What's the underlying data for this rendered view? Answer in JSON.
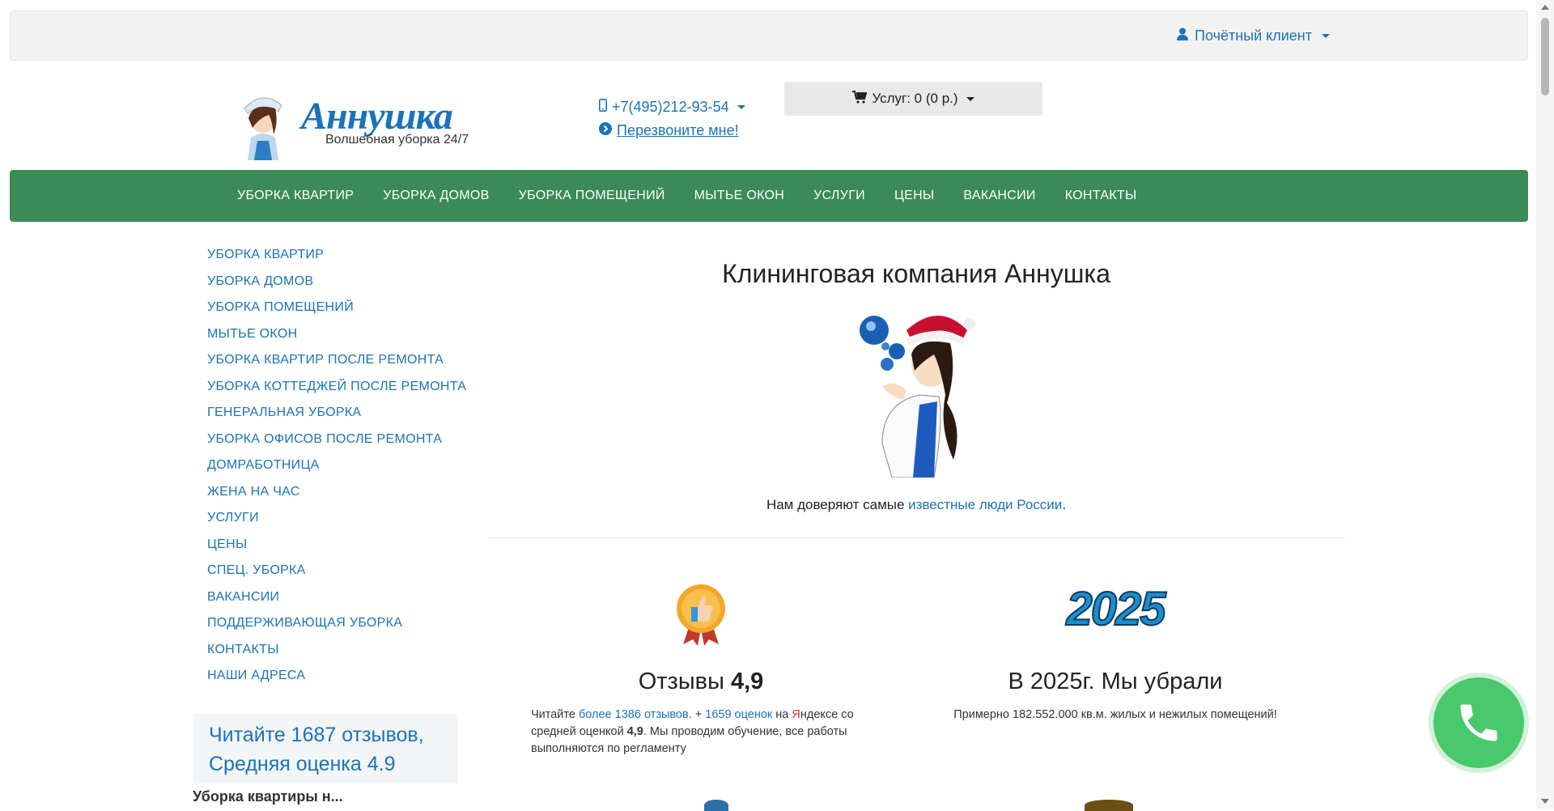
{
  "topbar": {
    "account_label": "Почётный клиент"
  },
  "header": {
    "logo_title": "Аннушка",
    "logo_subtitle": "Волшебная уборка 24/7",
    "phone": "+7(495)212-93-54",
    "callback": "Перезвоните мне!",
    "cart_label": "Услуг: 0 (0 р.)"
  },
  "mainnav": {
    "items": [
      "УБОРКА КВАРТИР",
      "УБОРКА ДОМОВ",
      "УБОРКА ПОМЕЩЕНИЙ",
      "МЫТЬЕ ОКОН",
      "УСЛУГИ",
      "ЦЕНЫ",
      "ВАКАНСИИ",
      "КОНТАКТЫ"
    ]
  },
  "sidebar": {
    "items": [
      "УБОРКА КВАРТИР",
      "УБОРКА ДОМОВ",
      "УБОРКА ПОМЕЩЕНИЙ",
      "МЫТЬЕ ОКОН",
      "УБОРКА КВАРТИР ПОСЛЕ РЕМОНТА",
      "УБОРКА КОТТЕДЖЕЙ ПОСЛЕ РЕМОНТА",
      "ГЕНЕРАЛЬНАЯ УБОРКА",
      "УБОРКА ОФИСОВ ПОСЛЕ РЕМОНТА",
      "ДОМРАБОТНИЦА",
      "ЖЕНА НА ЧАС",
      "УСЛУГИ",
      "ЦЕНЫ",
      "СПЕЦ. УБОРКА",
      "ВАКАНСИИ",
      "ПОДДЕРЖИВАЮЩАЯ УБОРКА",
      "КОНТАКТЫ",
      "НАШИ АДРЕСА"
    ],
    "reviews_line1": "Читайте 1687 отзывов,",
    "reviews_line2": "Средняя оценка 4.9",
    "subhead": "Уборка квартиры н..."
  },
  "main": {
    "title": "Клининговая компания Аннушка",
    "trust_prefix": "Нам доверяют самые ",
    "trust_link": "известные люди России",
    "trust_suffix": ".",
    "card1": {
      "title_prefix": "Отзывы ",
      "title_rating": "4,9",
      "t_read": "Читайте ",
      "t_link1": "более 1386 отзывов.",
      "t_plus": " + ",
      "t_link2": "1659 оценок",
      "t_on": " на ",
      "t_ya": "Я",
      "t_ndex": "ндексе со средней оценкой ",
      "t_rating": "4,9",
      "t_rest": ". Мы проводим обучение, все работы выполняются по регламенту"
    },
    "card2": {
      "badge": "2025",
      "title": "В 2025г. Мы убрали",
      "text": "Примерно 182.552.000 кв.м. жилых и нежилых помещений!"
    }
  },
  "colors": {
    "nav_green": "#3b8a57",
    "link_blue": "#1a73b8",
    "fab_green": "#48c96b"
  }
}
